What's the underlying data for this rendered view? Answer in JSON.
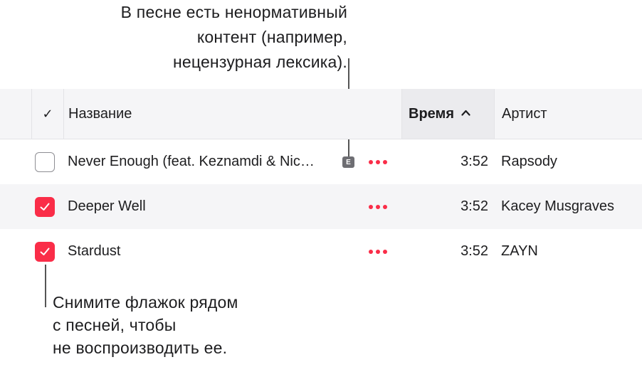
{
  "callouts": {
    "explicit": [
      "В песне есть ненормативный",
      "контент (например,",
      "нецензурная лексика)."
    ],
    "checkbox": [
      "Снимите флажок рядом",
      "с песней, чтобы",
      "не воспроизводить ее."
    ]
  },
  "table": {
    "headers": {
      "check": "✓",
      "name": "Название",
      "time": "Время",
      "artist": "Артист"
    },
    "sort": {
      "column": "time",
      "direction": "ascending"
    },
    "rows": [
      {
        "checked": false,
        "name": "Never Enough (feat. Keznamdi & Nic…",
        "explicit": true,
        "explicit_badge": "E",
        "time": "3:52",
        "artist": "Rapsody"
      },
      {
        "checked": true,
        "name": "Deeper Well",
        "explicit": false,
        "time": "3:52",
        "artist": "Kacey Musgraves"
      },
      {
        "checked": true,
        "name": "Stardust",
        "explicit": false,
        "time": "3:52",
        "artist": "ZAYN"
      }
    ]
  },
  "colors": {
    "accent": "#fa2d48",
    "header_bg": "#f5f5f7",
    "sorted_col_bg": "#ebebee"
  }
}
